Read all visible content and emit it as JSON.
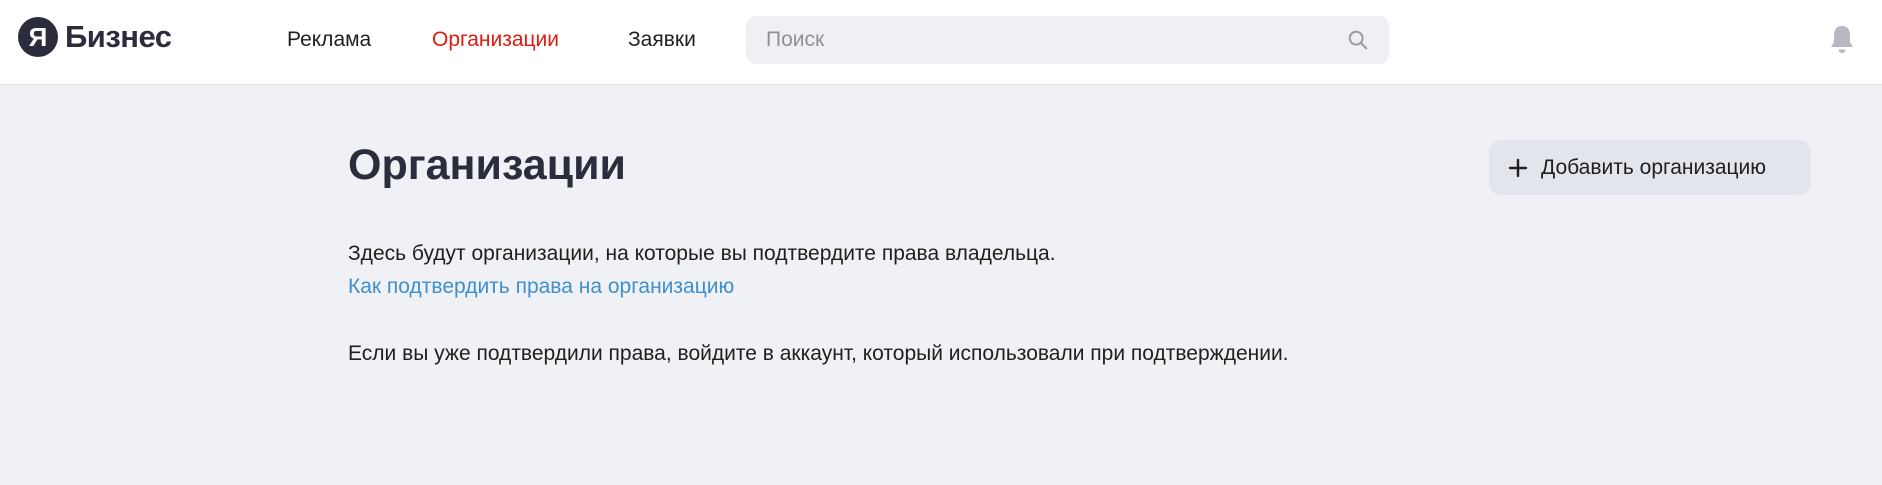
{
  "header": {
    "logo": {
      "mark": "Я",
      "text": "Бизнес"
    },
    "nav": {
      "ads": "Реклама",
      "organizations": "Организации",
      "requests": "Заявки"
    },
    "search": {
      "placeholder": "Поиск",
      "value": ""
    },
    "icons": {
      "search": "search-icon",
      "notifications": "bell-icon"
    }
  },
  "main": {
    "title": "Организации",
    "add_button": {
      "label": "Добавить организацию",
      "icon": "plus-icon"
    },
    "empty_text": "Здесь будут организации, на которые вы подтвердите права владельца.",
    "help_link": "Как подтвердить права на организацию",
    "login_hint": "Если вы уже подтвердили права, войдите в аккаунт, который использовали при подтверждении."
  },
  "colors": {
    "active_nav": "#e01a10",
    "link": "#3f8fce",
    "page_background": "#f0f1f4",
    "brand_dark": "#2b2d3c"
  }
}
